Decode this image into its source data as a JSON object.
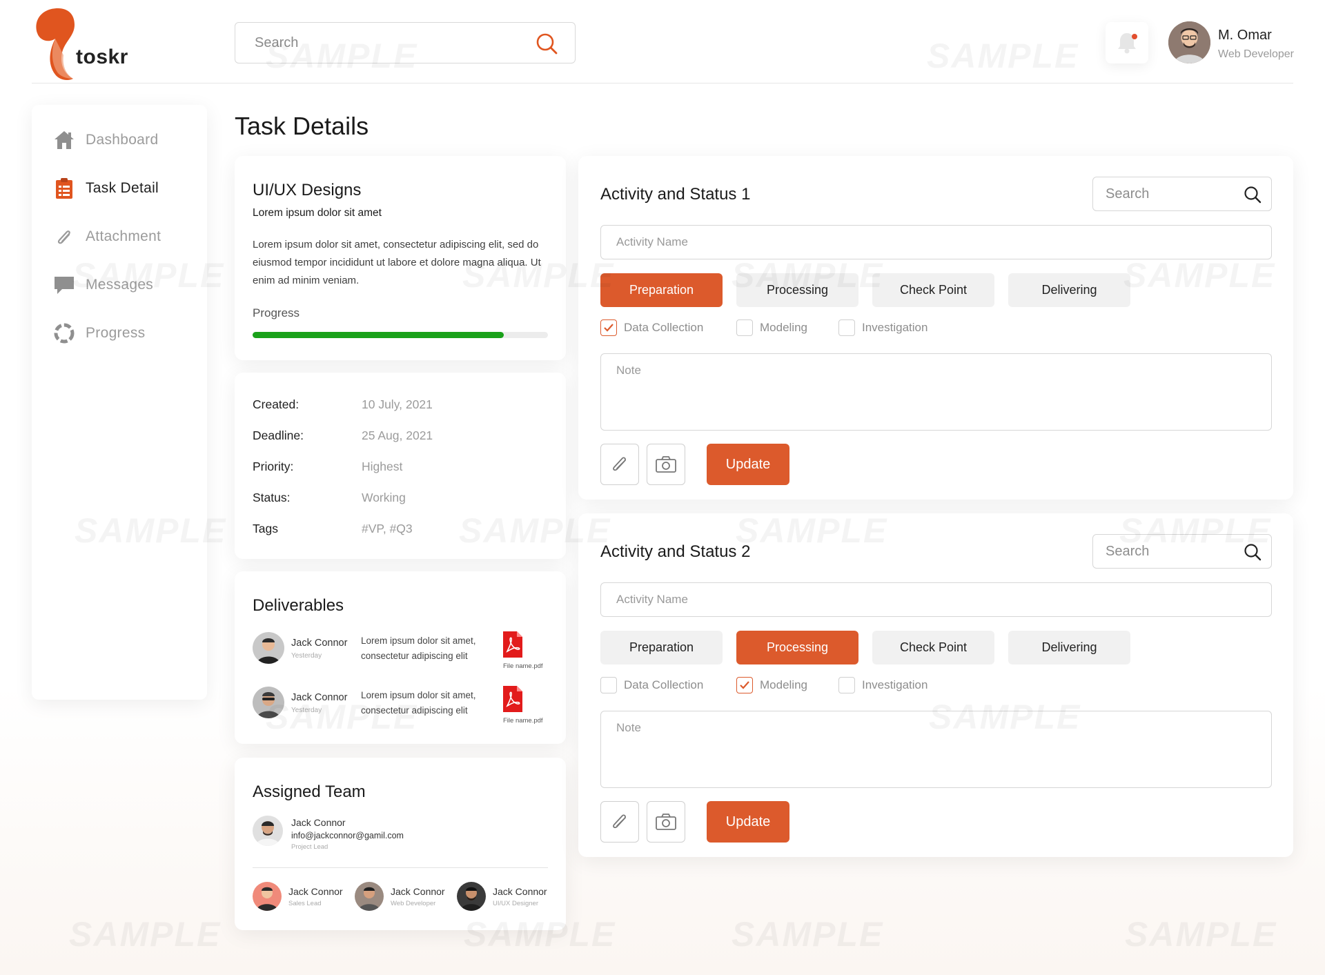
{
  "brand": {
    "name": "toskr",
    "accent": "#dc5a2c",
    "progress_color": "#1aa11a"
  },
  "header": {
    "search_placeholder": "Search",
    "search_icon": "search-icon",
    "notification_icon": "bell-icon",
    "user": {
      "name": "M. Omar",
      "role": "Web Developer"
    }
  },
  "sidebar": {
    "items": [
      {
        "label": "Dashboard",
        "icon": "home-icon",
        "active": false
      },
      {
        "label": "Task Detail",
        "icon": "clipboard-icon",
        "active": true
      },
      {
        "label": "Attachment",
        "icon": "paperclip-icon",
        "active": false
      },
      {
        "label": "Messages",
        "icon": "chat-icon",
        "active": false
      },
      {
        "label": "Progress",
        "icon": "progress-icon",
        "active": false
      }
    ]
  },
  "page": {
    "title": "Task Details"
  },
  "project": {
    "title": "UI/UX Designs",
    "subtitle": "Lorem ipsum dolor sit amet",
    "description": "Lorem ipsum dolor sit amet, consectetur adipiscing elit, sed do eiusmod tempor incididunt ut labore et dolore magna aliqua. Ut enim ad minim veniam.",
    "progress_label": "Progress",
    "progress_value": 0.85
  },
  "meta": [
    {
      "key": "Created:",
      "value": "10 July, 2021"
    },
    {
      "key": "Deadline:",
      "value": "25 Aug, 2021"
    },
    {
      "key": "Priority:",
      "value": "Highest"
    },
    {
      "key": "Status:",
      "value": "Working"
    },
    {
      "key": "Tags",
      "value": "#VP, #Q3"
    }
  ],
  "deliverables": {
    "title": "Deliverables",
    "items": [
      {
        "name": "Jack Connor",
        "time": "Yesterday",
        "text": "Lorem ipsum dolor sit amet, consectetur adipiscing elit",
        "file": "File name.pdf",
        "file_icon": "pdf-icon"
      },
      {
        "name": "Jack Connor",
        "time": "Yesterday",
        "text": "Lorem ipsum dolor sit amet, consectetur adipiscing elit",
        "file": "File name.pdf",
        "file_icon": "pdf-icon"
      }
    ]
  },
  "team": {
    "title": "Assigned Team",
    "lead": {
      "name": "Jack Connor",
      "email": "info@jackconnor@gamil.com",
      "role": "Project Lead"
    },
    "members": [
      {
        "name": "Jack Connor",
        "role": "Sales Lead"
      },
      {
        "name": "Jack Connor",
        "role": "Web Developer"
      },
      {
        "name": "Jack Connor",
        "role": "UI/UX Designer"
      }
    ]
  },
  "activities": [
    {
      "title": "Activity and Status 1",
      "search_placeholder": "Search",
      "name_placeholder": "Activity Name",
      "stages": [
        "Preparation",
        "Processing",
        "Check Point",
        "Delivering"
      ],
      "active_stage": 0,
      "checks": [
        {
          "label": "Data Collection",
          "checked": true
        },
        {
          "label": "Modeling",
          "checked": false
        },
        {
          "label": "Investigation",
          "checked": false
        }
      ],
      "note_placeholder": "Note",
      "attach_icon": "paperclip-icon",
      "camera_icon": "camera-icon",
      "update_label": "Update"
    },
    {
      "title": "Activity and Status 2",
      "search_placeholder": "Search",
      "name_placeholder": "Activity Name",
      "stages": [
        "Preparation",
        "Processing",
        "Check Point",
        "Delivering"
      ],
      "active_stage": 1,
      "checks": [
        {
          "label": "Data Collection",
          "checked": false
        },
        {
          "label": "Modeling",
          "checked": true
        },
        {
          "label": "Investigation",
          "checked": false
        }
      ],
      "note_placeholder": "Note",
      "attach_icon": "paperclip-icon",
      "camera_icon": "camera-icon",
      "update_label": "Update"
    }
  ],
  "watermark": "SAMPLE"
}
